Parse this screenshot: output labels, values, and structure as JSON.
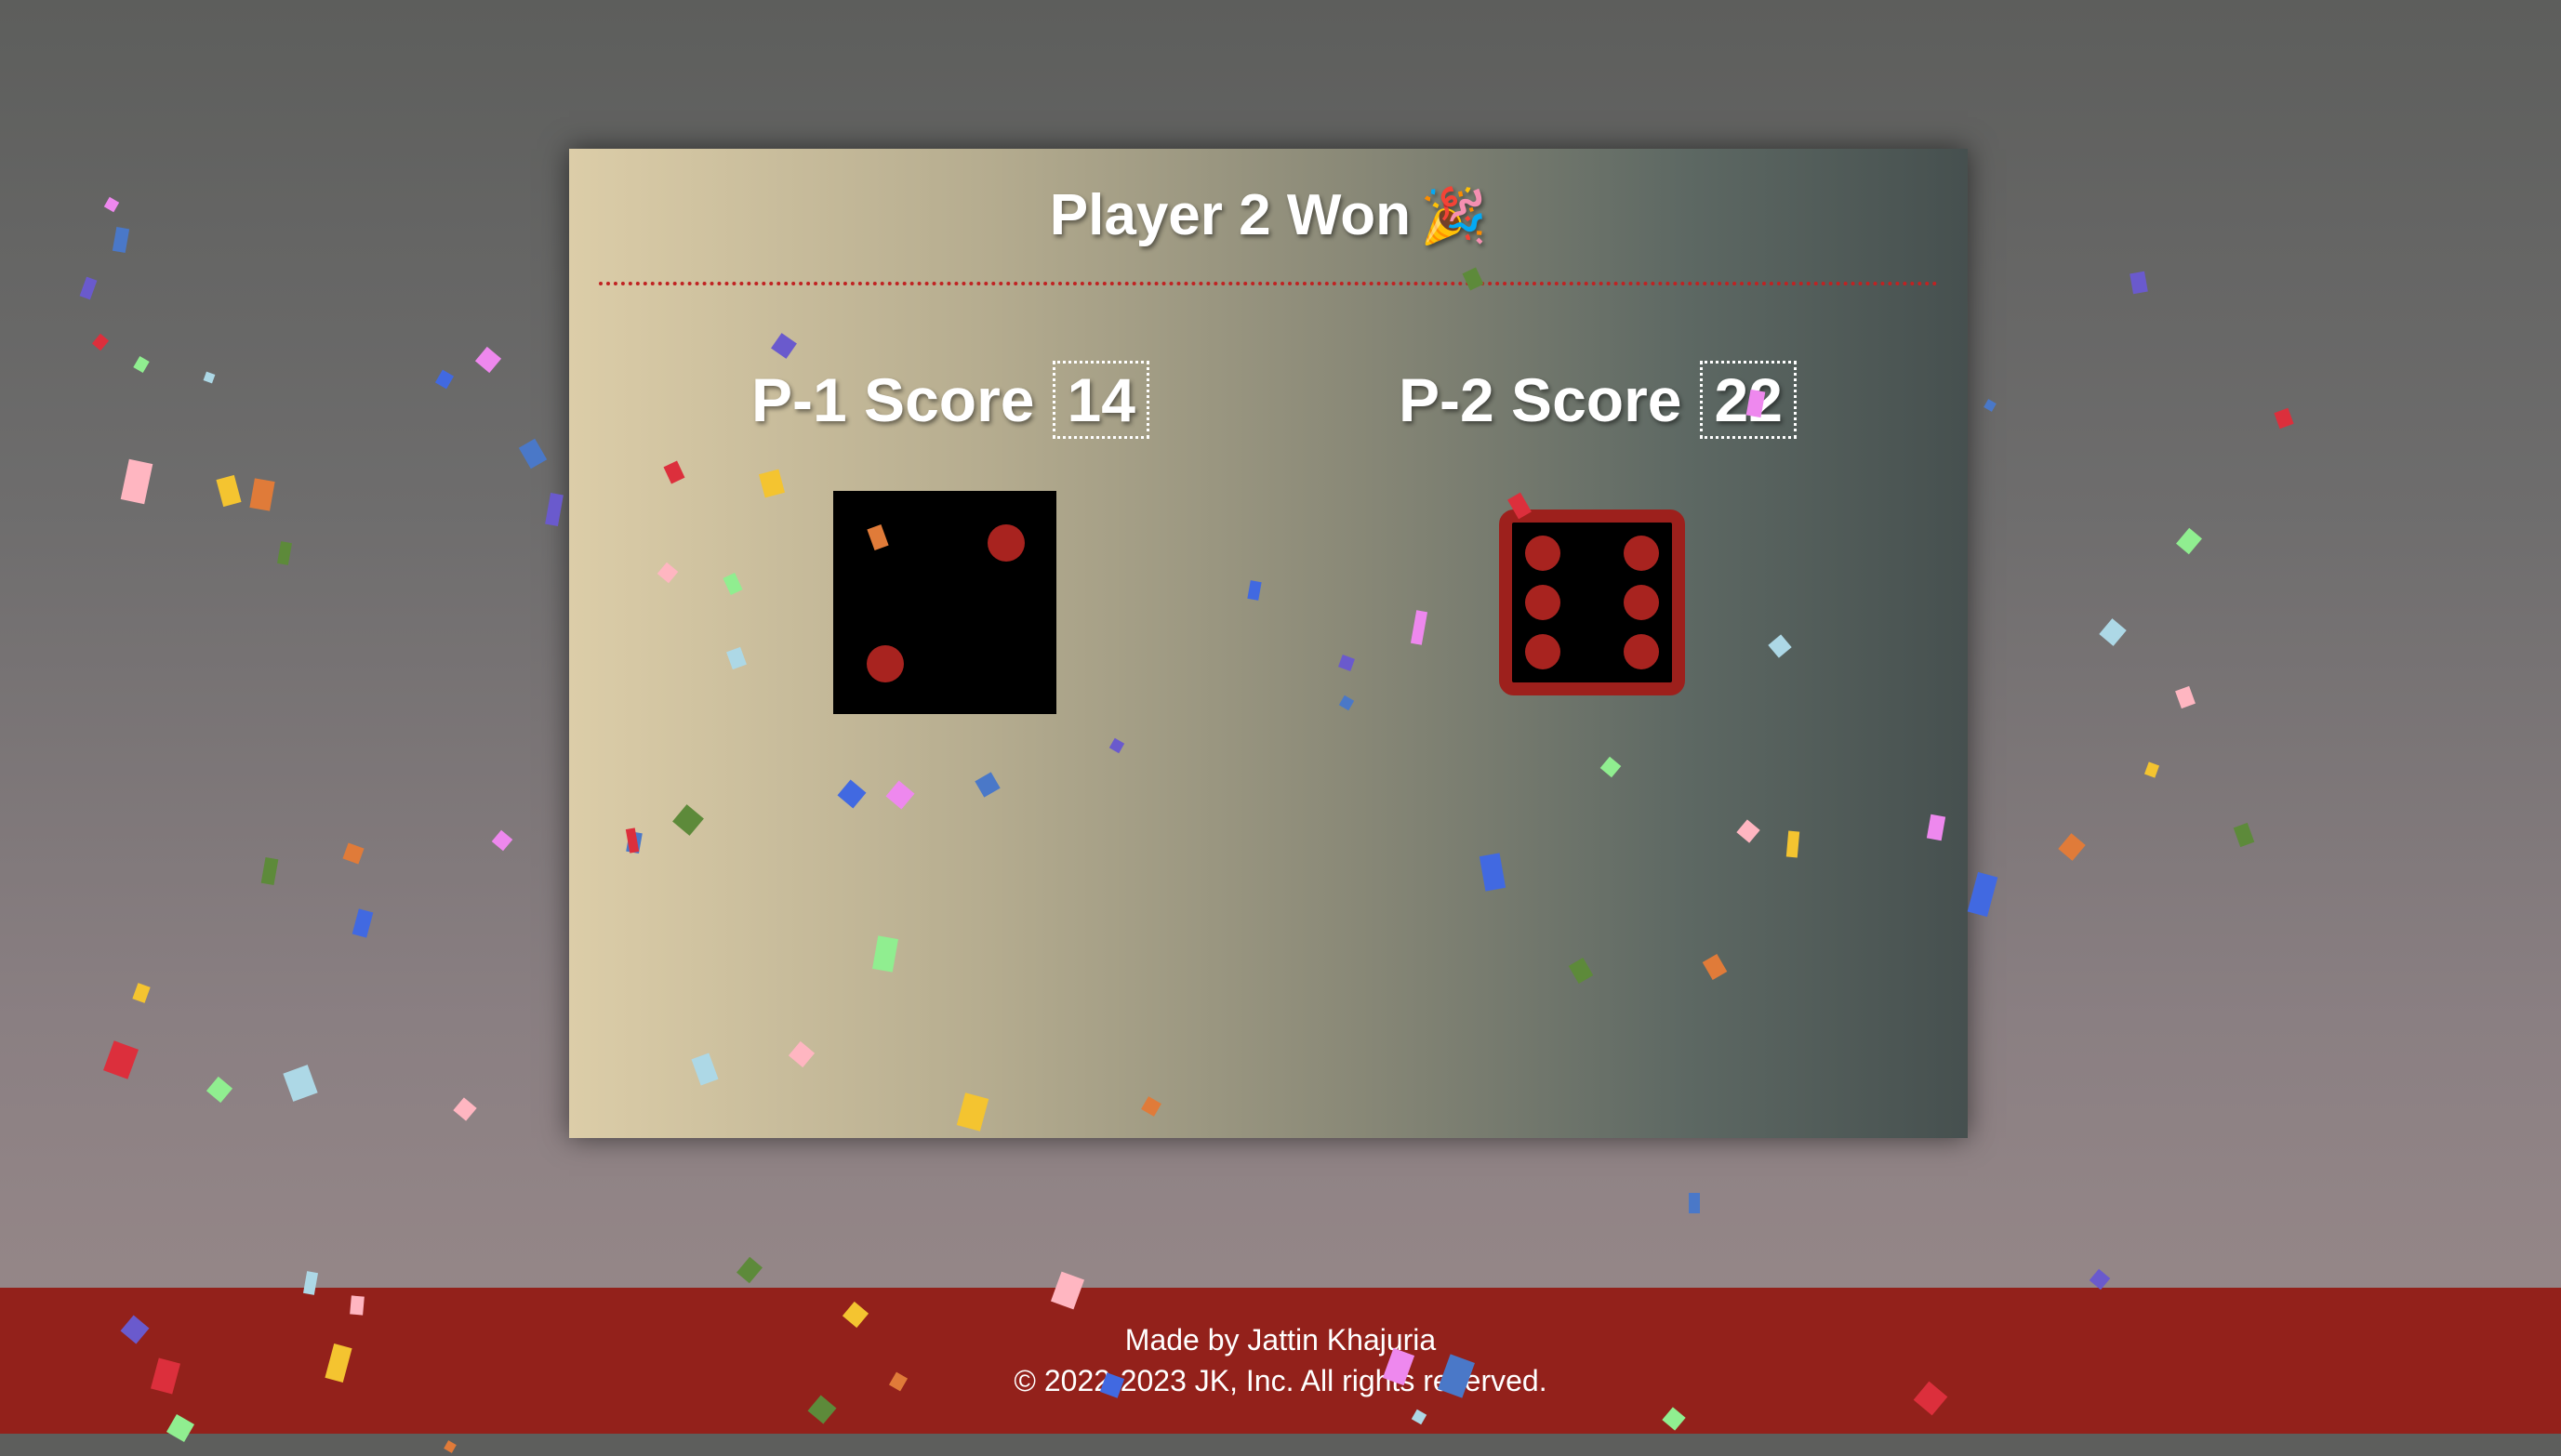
{
  "game": {
    "title": "Player 2 Won",
    "title_emoji": "🎉",
    "player1": {
      "label": "P-1 Score",
      "score": "14",
      "die_value": 2
    },
    "player2": {
      "label": "P-2 Score",
      "score": "22",
      "die_value": 6
    }
  },
  "footer": {
    "line1": "Made by Jattin Khajuria",
    "line2": "© 2022-2023 JK, Inc. All rights reserved."
  },
  "colors": {
    "accent": "#93211b",
    "pip": "#a8231f",
    "confetti": [
      "#ee88ee",
      "#4a78c8",
      "#6a5acd",
      "#dc2f3c",
      "#90ee90",
      "#add8e6",
      "#ffb6c1",
      "#f4c430",
      "#e07b39",
      "#5d8a3a",
      "#4169e1"
    ]
  },
  "icons": {
    "celebration": "party-popper-icon",
    "die1": "die-face-2-icon",
    "die2": "die-face-6-icon"
  }
}
